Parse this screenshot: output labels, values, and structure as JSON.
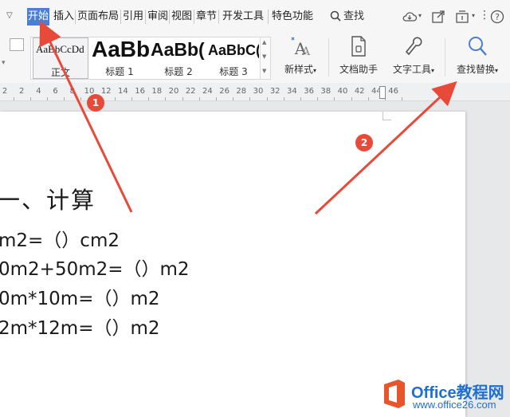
{
  "menu": {
    "tabs": [
      "开始",
      "插入",
      "页面布局",
      "引用",
      "审阅",
      "视图",
      "章节",
      "开发工具",
      "特色功能"
    ],
    "search_label": "查找"
  },
  "ribbon": {
    "styles": [
      {
        "preview": "AaBbCcDd",
        "label": "正文"
      },
      {
        "preview": "AaBb",
        "label": "标题 1"
      },
      {
        "preview": "AaBb(",
        "label": "标题 2"
      },
      {
        "preview": "AaBbC(",
        "label": "标题 3"
      }
    ],
    "new_style": "新样式",
    "doc_helper": "文档助手",
    "text_tools": "文字工具",
    "find_replace": "查找替换"
  },
  "ruler": {
    "numbers": [
      "2",
      "2",
      "4",
      "6",
      "8",
      "10",
      "12",
      "14",
      "16",
      "18",
      "20",
      "22",
      "24",
      "26",
      "28",
      "30",
      "32",
      "34",
      "36",
      "38",
      "40",
      "42",
      "44",
      "46"
    ]
  },
  "document": {
    "heading": "一、计算",
    "lines": [
      "m2=（）cm2",
      "0m2+50m2=（）m2",
      "0m*10m=（）m2",
      "2m*12m=（）m2"
    ]
  },
  "annotations": {
    "badge1": "1",
    "badge2": "2",
    "color": "#e84a3a"
  },
  "watermark": {
    "brand": "Office教程网",
    "url": "www.office26.com"
  }
}
